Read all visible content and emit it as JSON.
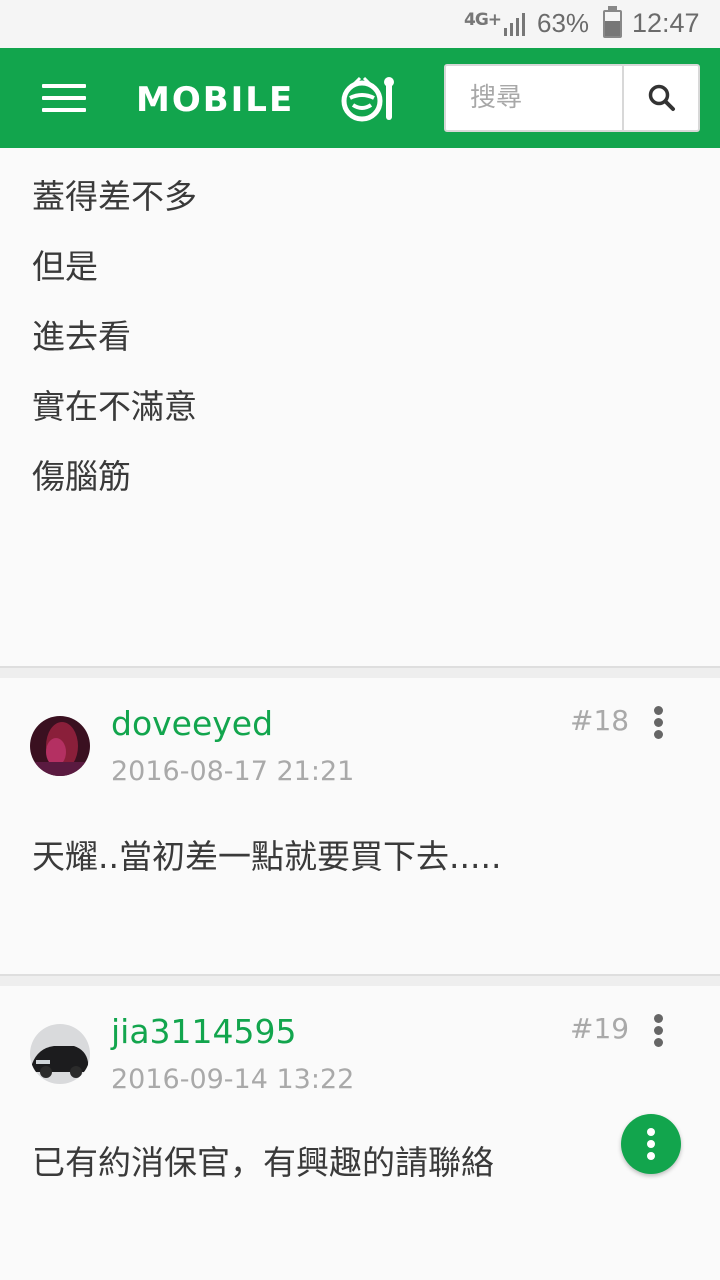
{
  "status_bar": {
    "network": "4G+",
    "battery_percent_label": "63%",
    "battery_level": 0.63,
    "time": "12:47"
  },
  "header": {
    "logo_text": "MOBILE",
    "search_placeholder": "搜尋",
    "brand_color": "#12a54d"
  },
  "previous_post": {
    "lines": [
      "蓋得差不多",
      "但是",
      "進去看",
      "實在不滿意",
      "傷腦筋"
    ]
  },
  "posts": [
    {
      "username": "doveeyed",
      "timestamp": "2016-08-17 21:21",
      "number": "#18",
      "body": "天耀..當初差一點就要買下去....."
    },
    {
      "username": "jia3114595",
      "timestamp": "2016-09-14 13:22",
      "number": "#19",
      "body": "已有約消保官，有興趣的請聯絡"
    }
  ],
  "icons": {
    "menu": "hamburger-icon",
    "search": "magnifier-icon",
    "more": "vertical-dots-icon",
    "fab": "vertical-dots-icon"
  }
}
